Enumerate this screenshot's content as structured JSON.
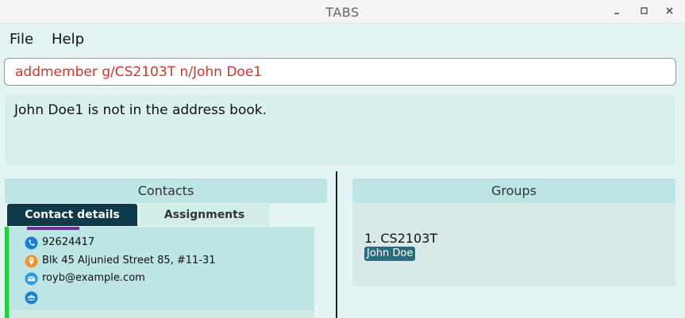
{
  "window": {
    "title": "TABS"
  },
  "menu": {
    "file": "File",
    "help": "Help"
  },
  "command": {
    "value": "addmember g/CS2103T n/John Doe1"
  },
  "result": {
    "message": "John Doe1 is not in the address book."
  },
  "contacts": {
    "header": "Contacts",
    "tabs": {
      "details": "Contact details",
      "assignments": "Assignments"
    },
    "card": {
      "phone": "92624417",
      "address": "Blk 45 Aljunied Street 85, #11-31",
      "email": "royb@example.com"
    }
  },
  "groups": {
    "header": "Groups",
    "items": [
      {
        "label": "1.  CS2103T",
        "members": [
          "John Doe"
        ]
      }
    ]
  },
  "colors": {
    "command_text": "#d1352b",
    "active_tab": "#0f3a4a",
    "card_accent": "#22d13d",
    "member_badge": "#2a6b7d"
  }
}
